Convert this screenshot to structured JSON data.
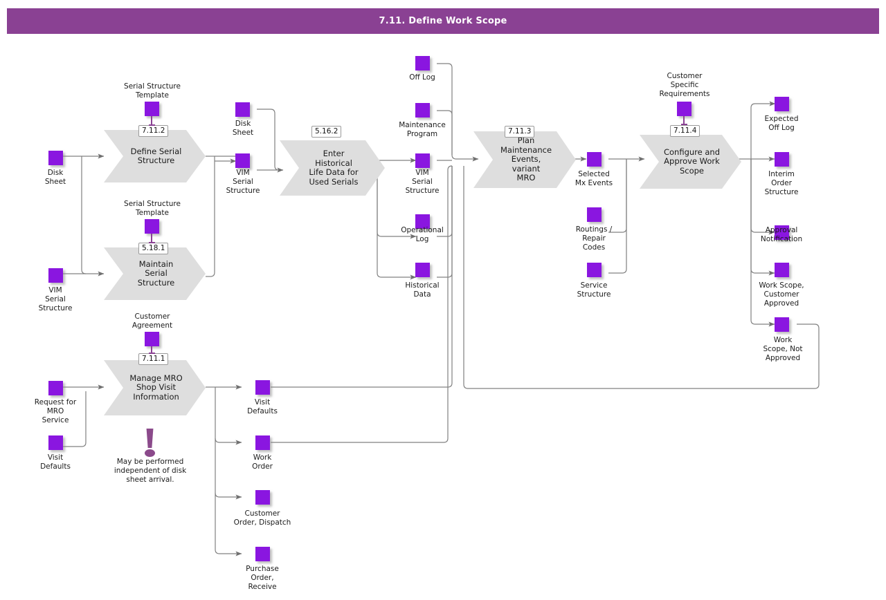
{
  "header": {
    "title": "7.11. Define Work Scope",
    "bar_color": "#8a4193",
    "text_color": "#ffffff"
  },
  "palette": {
    "object_purple": "#8a16e0",
    "process_gray": "#dedede",
    "connector_gray": "#808080",
    "note_purple": "#8b4a8b",
    "badge_border": "#9a9a9a"
  },
  "diagram": {
    "type": "process-flow",
    "processes": [
      {
        "id": "define-serial-structure",
        "badge": "7.11.2",
        "label": "Define Serial\nStructure"
      },
      {
        "id": "maintain-serial-structure",
        "badge": "5.18.1",
        "label": "Maintain Serial\nStructure"
      },
      {
        "id": "manage-mro-shop-visit",
        "badge": "7.11.1",
        "label": "Manage MRO\nShop Visit\nInformation"
      },
      {
        "id": "enter-historical-life-data",
        "badge": "5.16.2",
        "label": "Enter Historical\nLife Data for\nUsed Serials"
      },
      {
        "id": "plan-maintenance-events",
        "badge": "7.11.3",
        "label": "Plan\nMaintenance\nEvents, variant\nMRO"
      },
      {
        "id": "configure-approve-work-scope",
        "badge": "7.11.4",
        "label": "Configure and\nApprove Work\nScope"
      }
    ],
    "objects": [
      {
        "id": "disk-sheet-in",
        "label": "Disk\nSheet"
      },
      {
        "id": "vim-serial-structure-in",
        "label": "VIM\nSerial\nStructure"
      },
      {
        "id": "request-for-mro-service",
        "label": "Request for\nMRO\nService"
      },
      {
        "id": "visit-defaults-in",
        "label": "Visit\nDefaults"
      },
      {
        "id": "serial-structure-template-1",
        "label": "Serial Structure\nTemplate"
      },
      {
        "id": "serial-structure-template-2",
        "label": "Serial Structure\nTemplate"
      },
      {
        "id": "customer-agreement",
        "label": "Customer\nAgreement"
      },
      {
        "id": "disk-sheet-mid",
        "label": "Disk\nSheet"
      },
      {
        "id": "vim-serial-structure-mid",
        "label": "VIM\nSerial\nStructure"
      },
      {
        "id": "off-log",
        "label": "Off Log"
      },
      {
        "id": "maintenance-program",
        "label": "Maintenance\nProgram"
      },
      {
        "id": "vim-serial-structure-out",
        "label": "VIM\nSerial\nStructure"
      },
      {
        "id": "operational-log",
        "label": "Operational\nLog"
      },
      {
        "id": "historical-data",
        "label": "Historical\nData"
      },
      {
        "id": "selected-mx-events",
        "label": "Selected\nMx Events"
      },
      {
        "id": "routings-repair-codes",
        "label": "Routings /\nRepair\nCodes"
      },
      {
        "id": "service-structure",
        "label": "Service\nStructure"
      },
      {
        "id": "customer-specific-requirements",
        "label": "Customer\nSpecific\nRequirements"
      },
      {
        "id": "expected-off-log",
        "label": "Expected\nOff Log"
      },
      {
        "id": "interim-order-structure",
        "label": "Interim\nOrder\nStructure"
      },
      {
        "id": "approval-notification",
        "label": "Approval\nNotification"
      },
      {
        "id": "work-scope-customer-approved",
        "label": "Work Scope,\nCustomer\nApproved"
      },
      {
        "id": "work-scope-not-approved",
        "label": "Work\nScope, Not\nApproved"
      },
      {
        "id": "visit-defaults-out",
        "label": "Visit\nDefaults"
      },
      {
        "id": "work-order",
        "label": "Work\nOrder"
      },
      {
        "id": "customer-order-dispatch",
        "label": "Customer\nOrder, Dispatch"
      },
      {
        "id": "purchase-order-receive",
        "label": "Purchase\nOrder,\nReceive"
      }
    ],
    "note": {
      "id": "independent-note",
      "icon": "exclamation-icon",
      "text": "May be performed\nindependent of disk\nsheet arrival."
    }
  }
}
